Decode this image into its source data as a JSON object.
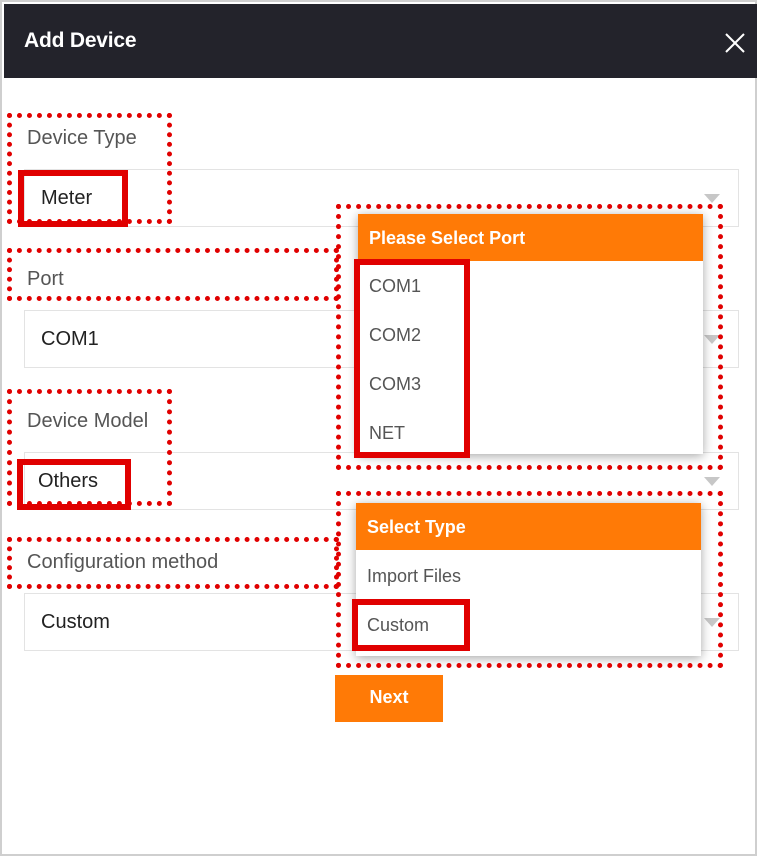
{
  "dialog": {
    "title": "Add Device"
  },
  "fields": {
    "device_type": {
      "label": "Device Type",
      "value": "Meter"
    },
    "port": {
      "label": "Port",
      "value": "COM1"
    },
    "device_model": {
      "label": "Device Model",
      "value": "Others"
    },
    "config_method": {
      "label": "Configuration method",
      "value": "Custom"
    }
  },
  "port_menu": {
    "header": "Please Select Port",
    "options": [
      "COM1",
      "COM2",
      "COM3",
      "NET"
    ]
  },
  "type_menu": {
    "header": "Select Type",
    "options": [
      "Import Files",
      "Custom"
    ]
  },
  "actions": {
    "next_label": "Next"
  },
  "colors": {
    "accent": "#ff7a06",
    "header_bg": "#23232b",
    "highlight": "#e00000"
  }
}
